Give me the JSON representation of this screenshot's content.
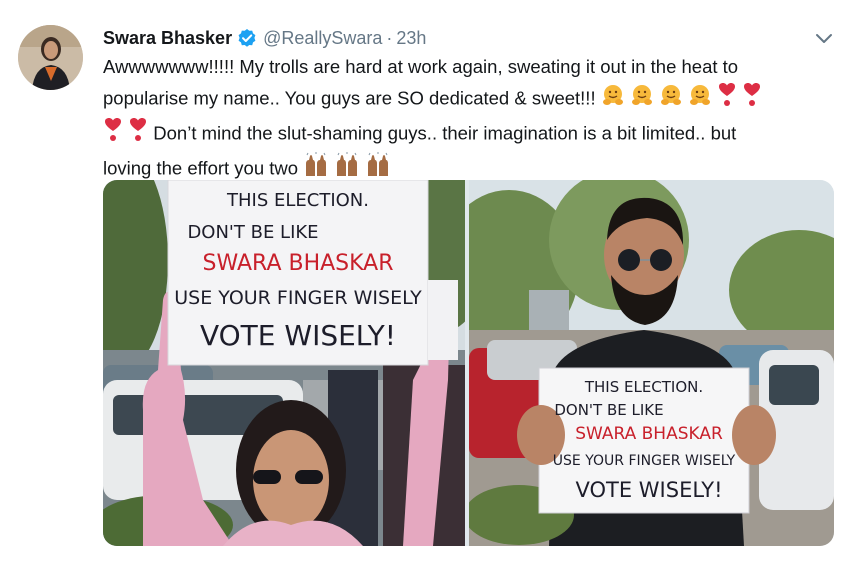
{
  "tweet": {
    "author_name": "Swara Bhasker",
    "handle": "@ReallySwara",
    "separator": "·",
    "time": "23h",
    "text_lines": [
      "Awwwwwww!!!!! My trolls are hard at work again, sweating it out in the heat to",
      "popularise my name.. You guys are SO dedicated & sweet!!!",
      "Don’t mind the slut-shaming guys.. their imagination is a bit limited.. but",
      "loving the effort you two"
    ]
  },
  "photos": {
    "left": {
      "sign_lines": [
        "THIS ELECTION.",
        "DON'T BE LIKE",
        "SWARA BHASKAR",
        "USE YOUR FINGER WISELY",
        "VOTE WISELY!"
      ]
    },
    "right": {
      "sign_lines": [
        "THIS ELECTION.",
        "DON'T BE LIKE",
        "SWARA BHASKAR",
        "USE YOUR FINGER WISELY",
        "VOTE WISELY!"
      ]
    }
  },
  "colors": {
    "verified": "#1da1f2",
    "sign_red": "#c8202b",
    "sign_ink": "#1d1d2a"
  }
}
